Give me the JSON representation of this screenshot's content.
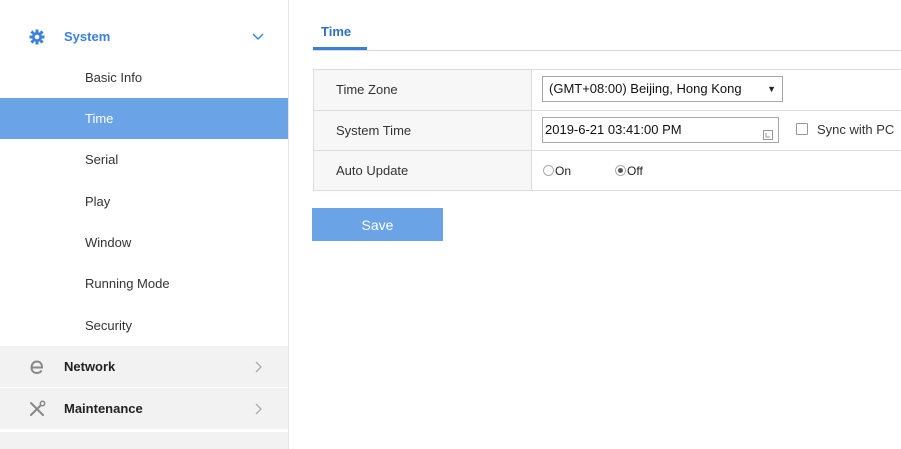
{
  "sidebar": {
    "system": {
      "label": "System",
      "icon": "gear-icon",
      "chevron": "chevron-down-icon"
    },
    "items": [
      {
        "label": "Basic Info"
      },
      {
        "label": "Time"
      },
      {
        "label": "Serial"
      },
      {
        "label": "Play"
      },
      {
        "label": "Window"
      },
      {
        "label": "Running Mode"
      },
      {
        "label": "Security"
      }
    ],
    "network": {
      "label": "Network",
      "icon": "browser-e-icon",
      "chevron": "chevron-right-icon"
    },
    "maintenance": {
      "label": "Maintenance",
      "icon": "tools-icon",
      "chevron": "chevron-right-icon"
    }
  },
  "main": {
    "tab": "Time",
    "rows": {
      "timezone": {
        "label": "Time Zone",
        "value": "(GMT+08:00) Beijing, Hong Kong"
      },
      "system_time": {
        "label": "System Time",
        "value": "2019-6-21 03:41:00 PM",
        "sync_label": "Sync with PC"
      },
      "auto_update": {
        "label": "Auto Update",
        "on_label": "On",
        "off_label": "Off",
        "selected": "Off"
      }
    },
    "save_label": "Save"
  },
  "colors": {
    "accent": "#6aa3e6",
    "active_text": "#3c7fdc",
    "collapsed_bg": "#f2f2f2"
  }
}
